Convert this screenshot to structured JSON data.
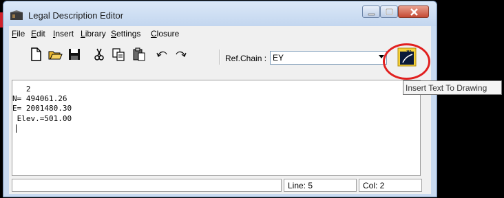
{
  "window": {
    "title": "Legal Description Editor"
  },
  "menu": [
    {
      "label": "File"
    },
    {
      "label": "Edit"
    },
    {
      "label": "Insert"
    },
    {
      "label": "Library"
    },
    {
      "label": "Settings"
    },
    {
      "label": "Closure"
    }
  ],
  "toolbar": {
    "buttons": [
      "new-icon",
      "open-icon",
      "save-icon",
      "cut-icon",
      "copy-icon",
      "paste-icon",
      "undo-icon",
      "redo-icon"
    ],
    "ref_chain_label": "Ref.Chain :",
    "ref_chain_value": "EY",
    "insert_button_icon": "insert-text-icon"
  },
  "editor": {
    "lines": [
      "   2",
      "N= 494061.26",
      "E= 2001480.30",
      " Elev.=501.00"
    ]
  },
  "status": {
    "message": "",
    "line": "Line: 5",
    "col": "Col: 2"
  },
  "tooltip": {
    "text": "Insert Text To Drawing"
  },
  "colors": {
    "highlight_ring": "#e1201f",
    "close_button": "#c44a35"
  }
}
